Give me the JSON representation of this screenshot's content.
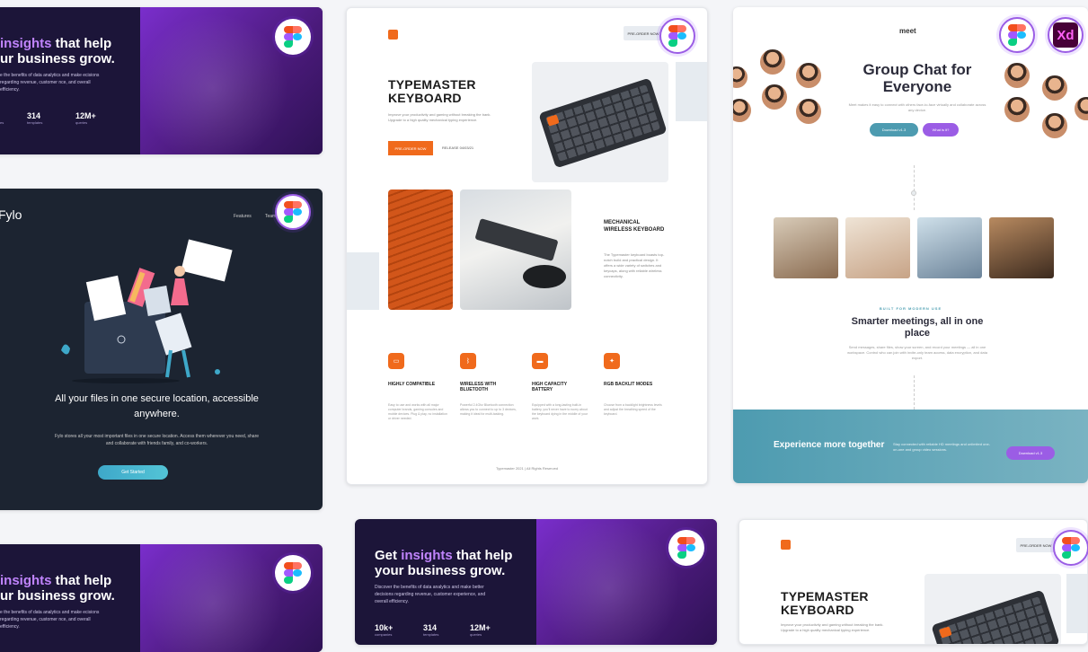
{
  "insights": {
    "headline_pre": "Get ",
    "headline_accent": "insights",
    "headline_post": " that help your business grow.",
    "partial_line1_accent": "insights",
    "partial_line1_post": " that help",
    "partial_line2": "ur business grow.",
    "partial_desc": "e the benefits of data analytics and make ecisions regarding revenue, customer nce, and overall efficiency.",
    "body": "Discover the benefits of data analytics and make better decisions regarding revenue, customer experience, and overall efficiency.",
    "stats": [
      {
        "value": "10k+",
        "label": "companies"
      },
      {
        "value": "314",
        "label": "templates"
      },
      {
        "value": "12M+",
        "label": "queries"
      }
    ],
    "partial_stat_label": "es"
  },
  "fylo": {
    "logo": "Fylo",
    "nav": [
      "Features",
      "Team"
    ],
    "headline": "All your files in one secure location, accessible anywhere.",
    "body": "Fylo stores all your most important files in one secure location. Access them wherever you need, share and collaborate with friends family, and co-workers.",
    "cta": "Get Started"
  },
  "typemaster": {
    "title": "TYPEMASTER KEYBOARD",
    "desc": "Improve your productivity and gaming without breaking the bank. Upgrade to a high quality mechanical typing experience.",
    "preorder": "PRE-ORDER NOW",
    "release": "RELEASE 04/03/21",
    "pre_order_top": "PRE-ORDER NOW",
    "sub_title": "MECHANICAL WIRELESS KEYBOARD",
    "sub_desc": "The Typemaster keyboard boasts top-notch build and practical design. It offers a wide variety of switches and keycaps, along with reliable wireless connectivity.",
    "features": [
      {
        "title": "HIGHLY COMPATIBLE",
        "desc": "Easy to use and works with all major computer brands, gaming consoles and mobile devices. Plug & play, no installation or driver needed."
      },
      {
        "title": "WIRELESS WITH BLUETOOTH",
        "desc": "Powerful 2.4Ghz Bluetooth connection allows you to connect to up to 3 devices, making it ideal for multi-tasking."
      },
      {
        "title": "HIGH CAPACITY BATTERY",
        "desc": "Equipped with a long-lasting built-in battery, you'll never have to worry about the keyboard dying in the middle of your work."
      },
      {
        "title": "RGB BACKLIT MODES",
        "desc": "Choose from a backlight brightness levels and adjust the breathing speed of the keyboard."
      }
    ],
    "footer": "Typemaster 2021 | All Rights Reserved"
  },
  "meet": {
    "brand": "meet",
    "title": "Group Chat for Everyone",
    "lead": "Meet makes it easy to connect with others face-to-face virtually and collaborate across any device.",
    "btn_download": "Download v1.3",
    "btn_what": "What is it?",
    "eyebrow": "BUILT FOR MODERN USE",
    "h2": "Smarter meetings, all in one place",
    "para": "Send messages, share files, show your screen, and record your meetings — all in one workspace. Control who can join with invite-only team access, data encryption, and data export.",
    "band_title": "Experience more together",
    "band_text": "Stay connected with reliable HD meetings and unlimited one-on-one and group video sessions.",
    "band_btn": "Download v1.3"
  },
  "badges": {
    "figma": "figma-icon",
    "xd": "Xd"
  },
  "colors": {
    "accent_orange": "#f06a1c",
    "insights_purple": "#c084fc",
    "fylo_teal": "#3ea8c9",
    "meet_teal": "#4d9bb0"
  }
}
